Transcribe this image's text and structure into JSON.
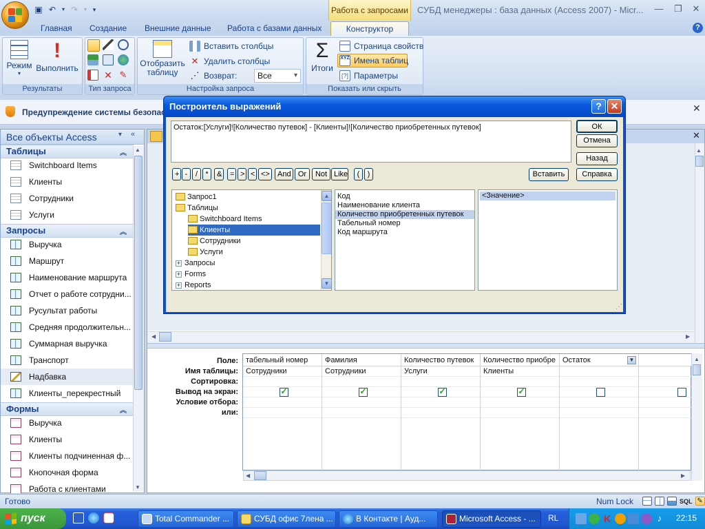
{
  "window": {
    "context_tab_title": "Работа с запросами",
    "app_title": "СУБД менеджеры : база данных (Access 2007) - Micr..."
  },
  "ribbon": {
    "tabs": [
      "Главная",
      "Создание",
      "Внешние данные",
      "Работа с базами данных",
      "Конструктор"
    ],
    "groups": {
      "results": {
        "label": "Результаты",
        "mode": "Режим",
        "run": "Выполнить"
      },
      "query_type": {
        "label": "Тип запроса"
      },
      "setup": {
        "label": "Настройка запроса",
        "show_table": "Отобразить таблицу",
        "insert_columns": "Вставить столбцы",
        "delete_columns": "Удалить столбцы",
        "return_label": "Возврат:",
        "return_value": "Все"
      },
      "totals": {
        "totals": "Итоги"
      },
      "show_hide": {
        "label": "Показать или скрыть",
        "property_sheet": "Страница свойств",
        "table_names": "Имена таблиц",
        "parameters": "Параметры"
      }
    }
  },
  "warning": {
    "text": "Предупреждение системы безопасно"
  },
  "nav": {
    "header": "Все объекты Access",
    "sections": [
      {
        "title": "Таблицы",
        "items": [
          "Switchboard Items",
          "Клиенты",
          "Сотрудники",
          "Услуги"
        ]
      },
      {
        "title": "Запросы",
        "items": [
          "Выручка",
          "Маршрут",
          "Наименование маршрута",
          "Отчет о работе сотрудни...",
          "Русультат работы",
          "Средняя продолжительн...",
          "Суммарная выручка",
          "Транспорт",
          "Надбавка",
          "Клиенты_перекрестный"
        ]
      },
      {
        "title": "Формы",
        "items": [
          "Выручка",
          "Клиенты",
          "Клиенты подчиненная ф...",
          "Кнопочная форма",
          "Работа с клиентами"
        ]
      }
    ]
  },
  "dialog": {
    "title": "Построитель выражений",
    "expression": "Остаток:[Услуги]![Количество путевок] - [Клиенты]![Количество приобретенных путевок]",
    "buttons": {
      "ok": "ОК",
      "cancel": "Отмена",
      "back": "Назад",
      "insert": "Вставить",
      "help": "Справка"
    },
    "operators": [
      "+",
      "-",
      "/",
      "*",
      "&",
      "=",
      ">",
      "<",
      "<>",
      "And",
      "Or",
      "Not",
      "Like",
      "(",
      ")"
    ],
    "tree": [
      "Запрос1",
      "Таблицы",
      "Switchboard Items",
      "Клиенты",
      "Сотрудники",
      "Услуги",
      "Запросы",
      "Forms",
      "Reports"
    ],
    "fields": [
      "Код",
      "Наименование клиента",
      "Количество приобретенных путевок",
      "Табельный номер",
      "Код маршрута"
    ],
    "values": [
      "<Значение>"
    ]
  },
  "grid": {
    "labels": [
      "Поле:",
      "Имя таблицы:",
      "Сортировка:",
      "Вывод на экран:",
      "Условие отбора:",
      "или:"
    ],
    "columns": [
      {
        "field": "табельный номер",
        "table": "Сотрудники",
        "show": true
      },
      {
        "field": "Фамилия",
        "table": "Сотрудники",
        "show": true
      },
      {
        "field": "Количество путевок",
        "table": "Услуги",
        "show": true
      },
      {
        "field": "Количество приобре",
        "table": "Клиенты",
        "show": true
      },
      {
        "field": "Остаток",
        "table": "",
        "show": false
      },
      {
        "field": "",
        "table": "",
        "show": false
      }
    ]
  },
  "status": {
    "left": "Готово",
    "num_lock": "Num Lock",
    "sql": "SQL"
  },
  "taskbar": {
    "start": "пуск",
    "buttons": [
      "Total Commander ...",
      "СУБД офис 7лена ...",
      "В Контакте | Ауд...",
      "Microsoft Access - ..."
    ],
    "lang": "RL",
    "time": "22:15"
  }
}
